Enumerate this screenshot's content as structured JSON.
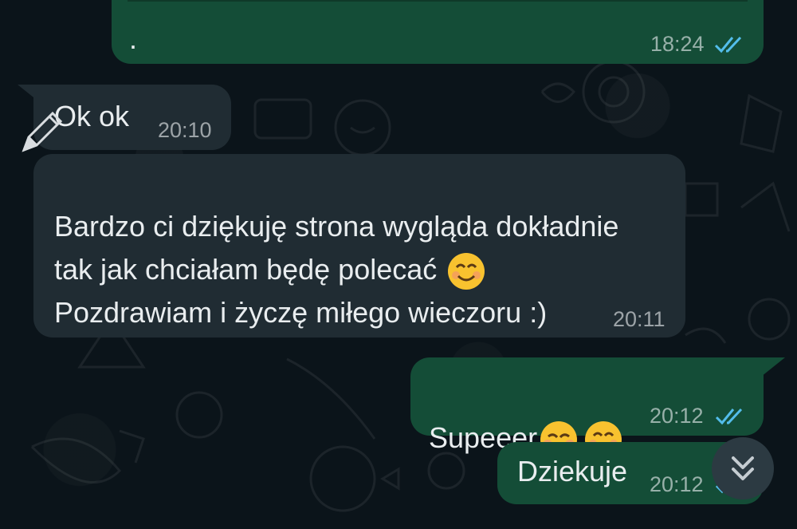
{
  "messages": [
    {
      "id": "m1",
      "text": ".",
      "time": "18:24",
      "read": true
    },
    {
      "id": "m2",
      "text": "Ok ok",
      "time": "20:10"
    },
    {
      "id": "m3",
      "text": "Bardzo ci dziękuję strona wygląda dokładnie\ntak jak chciałam będę polecać",
      "text_line3": "Pozdrawiam i życzę miłego wieczoru :)",
      "time": "20:11"
    },
    {
      "id": "m4",
      "text": "Supeeer",
      "time": "20:12",
      "read": true
    },
    {
      "id": "m5",
      "text": "Dziekuje",
      "time": "20:12",
      "read": true
    }
  ],
  "icons": {
    "scroll": "chevrons-down-icon",
    "read_receipt": "double-check-icon",
    "pen": "pen-icon"
  },
  "colors": {
    "outgoing": "#144d37",
    "incoming": "#202c33",
    "tick": "#53bdeb",
    "background": "#0b141a"
  }
}
